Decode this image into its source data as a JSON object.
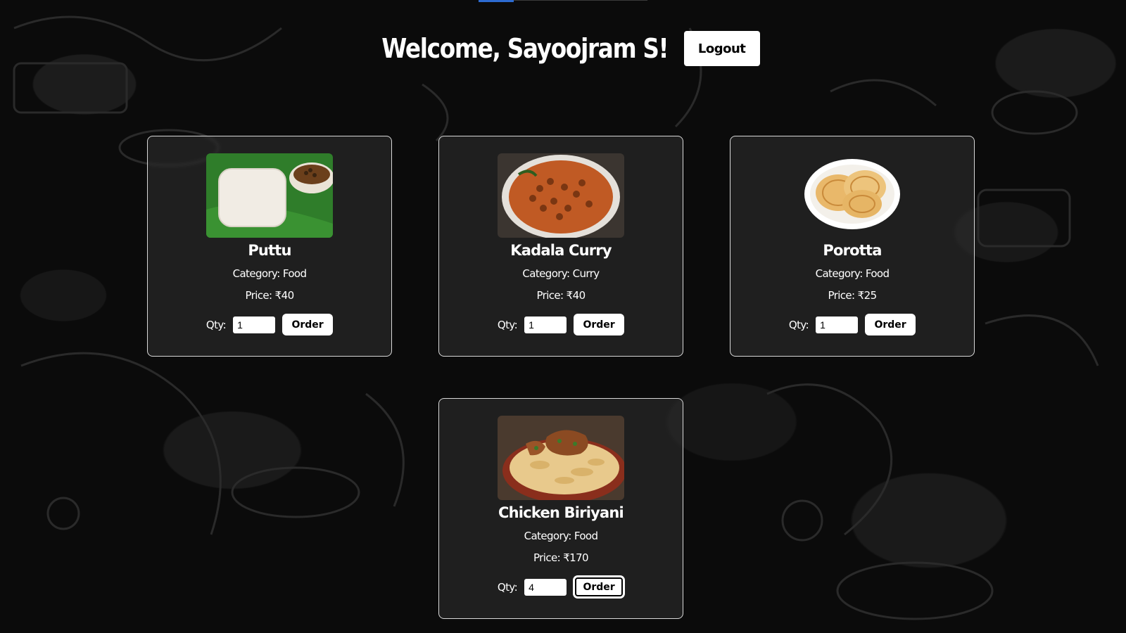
{
  "header": {
    "welcome_text": "Welcome, Sayoojram S!",
    "logout_label": "Logout"
  },
  "labels": {
    "qty": "Qty:",
    "order": "Order"
  },
  "items": [
    {
      "name": "Puttu",
      "category": "Category: Food",
      "price": "Price: ₹40",
      "qty": "1",
      "image": "puttu-image"
    },
    {
      "name": "Kadala Curry",
      "category": "Category: Curry",
      "price": "Price: ₹40",
      "qty": "1",
      "image": "kadala-curry-image"
    },
    {
      "name": "Porotta",
      "category": "Category: Food",
      "price": "Price: ₹25",
      "qty": "1",
      "image": "porotta-image"
    },
    {
      "name": "Chicken Biriyani",
      "category": "Category: Food",
      "price": "Price: ₹170",
      "qty": "4",
      "image": "chicken-biriyani-image"
    }
  ],
  "colors": {
    "background": "#0b0b0b",
    "card_border": "#d9d9d9",
    "button_bg": "#ffffff"
  }
}
